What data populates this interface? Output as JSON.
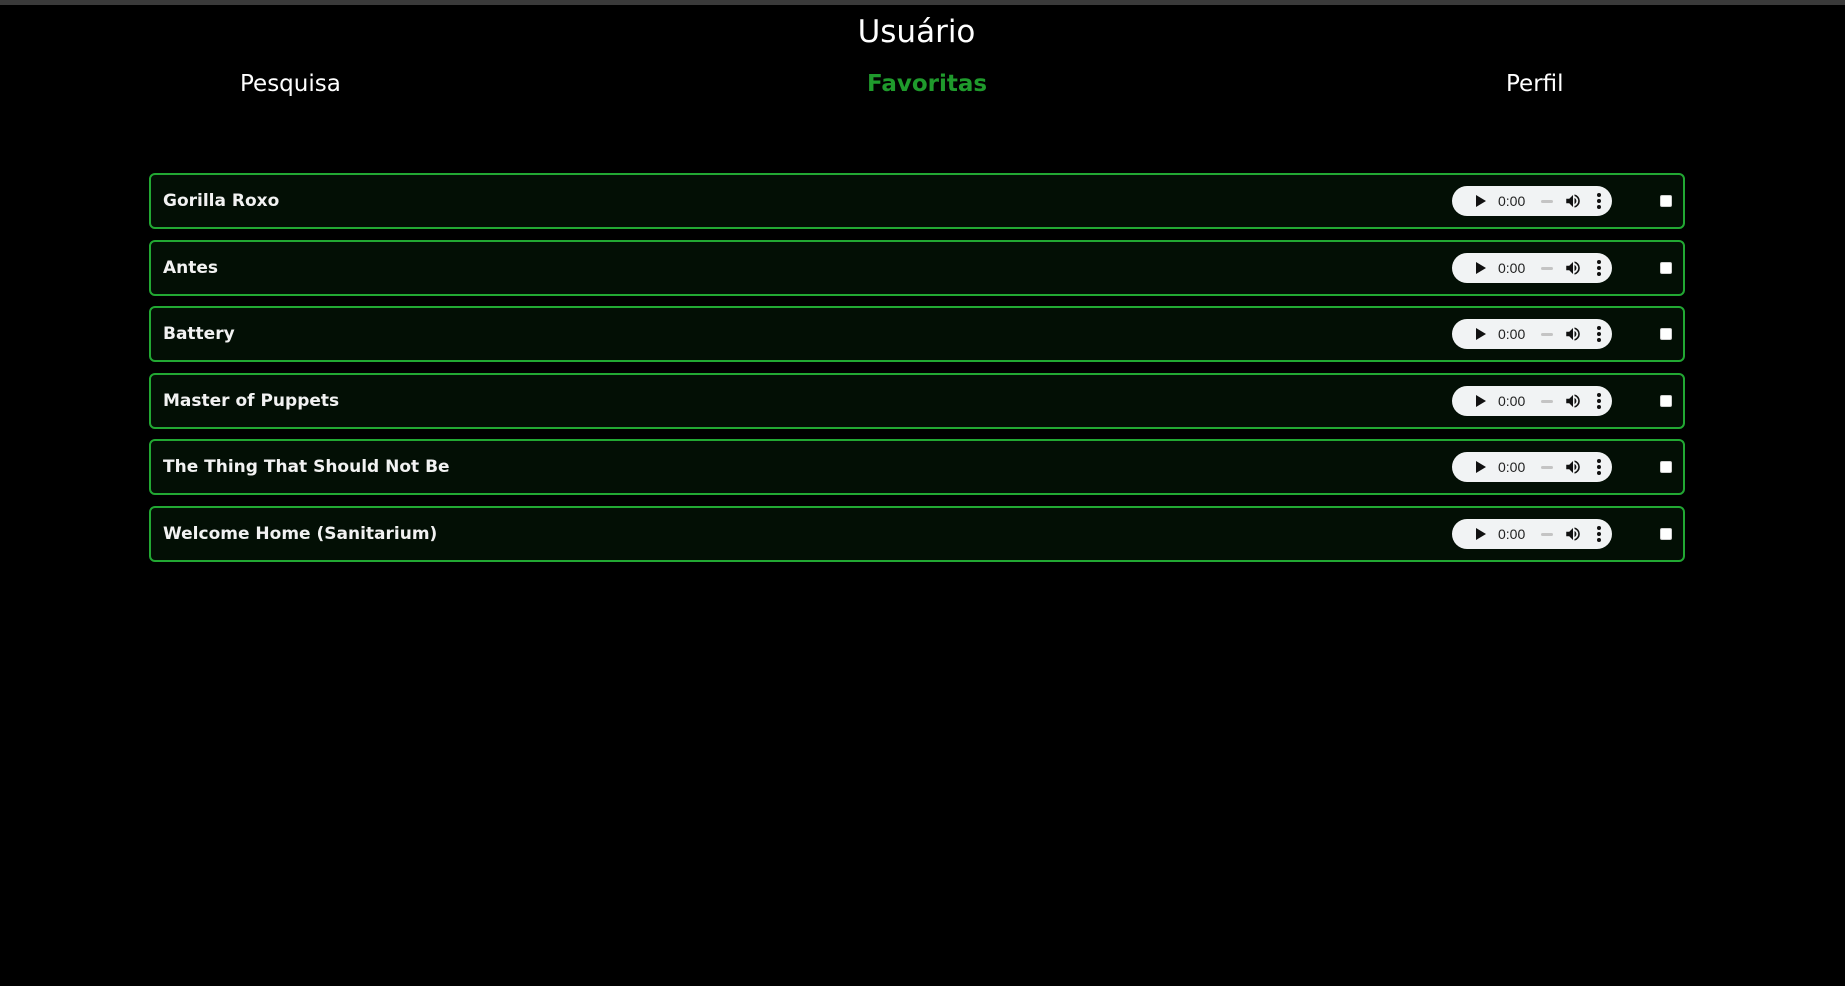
{
  "header": {
    "title": "Usuário"
  },
  "nav": {
    "items": [
      {
        "label": "Pesquisa",
        "active": false
      },
      {
        "label": "Favoritas",
        "active": true
      },
      {
        "label": "Perfil",
        "active": false
      }
    ]
  },
  "colors": {
    "background": "#000000",
    "accent": "#1f9a2c",
    "row_border": "#22a833",
    "row_background": "#030f05",
    "text": "#ffffff"
  },
  "favorites": [
    {
      "title": "Gorilla Roxo",
      "time": "0:00",
      "selected": false
    },
    {
      "title": "Antes",
      "time": "0:00",
      "selected": false
    },
    {
      "title": "Battery",
      "time": "0:00",
      "selected": false
    },
    {
      "title": "Master of Puppets",
      "time": "0:00",
      "selected": false
    },
    {
      "title": "The Thing That Should Not Be",
      "time": "0:00",
      "selected": false
    },
    {
      "title": "Welcome Home (Sanitarium)",
      "time": "0:00",
      "selected": false
    }
  ],
  "player_icons": [
    "play-icon",
    "volume-icon",
    "more-options-icon"
  ]
}
